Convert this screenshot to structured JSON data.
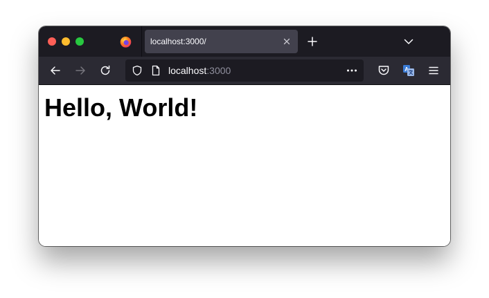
{
  "window": {
    "traffic_lights": {
      "close_color": "#ff5f57",
      "minimize_color": "#febc2e",
      "maximize_color": "#28c840"
    }
  },
  "tabstrip": {
    "browser_icon": "firefox-logo-icon",
    "tabs": [
      {
        "title": "localhost:3000/",
        "active": true,
        "close_icon": "close-icon"
      }
    ],
    "new_tab_icon": "plus-icon",
    "tab_list_icon": "chevron-down-icon"
  },
  "navbar": {
    "back_icon": "back-arrow-icon",
    "forward_icon": "forward-arrow-icon",
    "reload_icon": "reload-icon",
    "url": {
      "host": "localhost",
      "port": ":3000",
      "shield_icon": "shield-icon",
      "page_icon": "page-icon",
      "more_icon": "ellipsis-icon"
    },
    "pocket_icon": "pocket-icon",
    "translate_icon": "translate-icon",
    "menu_icon": "hamburger-menu-icon"
  },
  "page": {
    "heading": "Hello, World!"
  },
  "colors": {
    "tabstrip_bg": "#1c1b22",
    "active_tab_bg": "#42414d",
    "navbar_bg": "#2b2a33",
    "urlbar_bg": "#1c1b22",
    "translate_accent": "#3a7bd5"
  }
}
